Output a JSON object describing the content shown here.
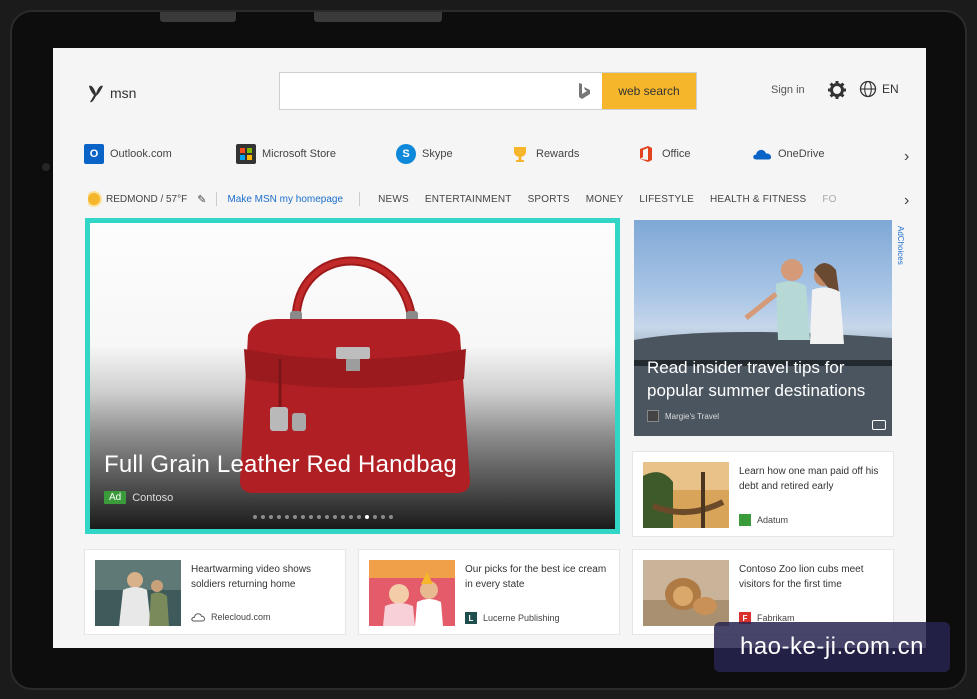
{
  "header": {
    "logo_text": "msn",
    "search_placeholder": "",
    "search_button": "web search",
    "signin": "Sign in",
    "language": "EN"
  },
  "apps": [
    {
      "label": "Outlook.com",
      "icon": "outlook-icon",
      "color": "#0a64c8"
    },
    {
      "label": "Microsoft Store",
      "icon": "store-icon",
      "color": "#333333"
    },
    {
      "label": "Skype",
      "icon": "skype-icon",
      "color": "#0e88d8"
    },
    {
      "label": "Rewards",
      "icon": "trophy-icon",
      "color": "#f6b62b"
    },
    {
      "label": "Office",
      "icon": "office-icon",
      "color": "#e2431c"
    },
    {
      "label": "OneDrive",
      "icon": "onedrive-icon",
      "color": "#0a64c8"
    }
  ],
  "nav": {
    "weather": "REDMOND / 57°F",
    "make_home": "Make MSN my homepage",
    "items": [
      "NEWS",
      "ENTERTAINMENT",
      "SPORTS",
      "MONEY",
      "LIFESTYLE",
      "HEALTH & FITNESS",
      "FO"
    ]
  },
  "hero": {
    "title": "Full Grain Leather Red Handbag",
    "badge": "Ad",
    "source": "Contoso",
    "slide_count": 18,
    "active_slide": 14,
    "accent": "#31d6c6"
  },
  "feature": {
    "title": "Read insider travel tips for popular summer destinations",
    "source": "Margie's Travel",
    "adchoices": "AdChoices"
  },
  "cards": [
    {
      "title": "Learn how one man paid off his debt and retired early",
      "source": "Adatum",
      "src_color": "#3a9b3a",
      "src_letter": ""
    },
    {
      "title": "Heartwarming video shows soldiers returning home",
      "source": "Relecloud.com",
      "src_color": "",
      "src_letter": ""
    },
    {
      "title": "Our picks for the best ice cream in every state",
      "source": "Lucerne Publishing",
      "src_color": "#1f4e4e",
      "src_letter": "L"
    },
    {
      "title": "Contoso Zoo lion cubs meet visitors for the first time",
      "source": "Fabrikam",
      "src_color": "#d9322e",
      "src_letter": "F"
    }
  ],
  "watermark": "hao-ke-ji.com.cn"
}
